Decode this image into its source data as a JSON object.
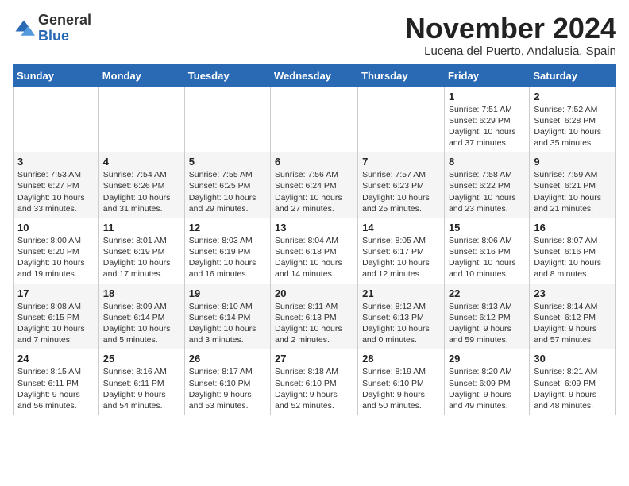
{
  "logo": {
    "general": "General",
    "blue": "Blue"
  },
  "header": {
    "month": "November 2024",
    "location": "Lucena del Puerto, Andalusia, Spain"
  },
  "weekdays": [
    "Sunday",
    "Monday",
    "Tuesday",
    "Wednesday",
    "Thursday",
    "Friday",
    "Saturday"
  ],
  "weeks": [
    [
      {
        "day": "",
        "info": ""
      },
      {
        "day": "",
        "info": ""
      },
      {
        "day": "",
        "info": ""
      },
      {
        "day": "",
        "info": ""
      },
      {
        "day": "",
        "info": ""
      },
      {
        "day": "1",
        "info": "Sunrise: 7:51 AM\nSunset: 6:29 PM\nDaylight: 10 hours and 37 minutes."
      },
      {
        "day": "2",
        "info": "Sunrise: 7:52 AM\nSunset: 6:28 PM\nDaylight: 10 hours and 35 minutes."
      }
    ],
    [
      {
        "day": "3",
        "info": "Sunrise: 7:53 AM\nSunset: 6:27 PM\nDaylight: 10 hours and 33 minutes."
      },
      {
        "day": "4",
        "info": "Sunrise: 7:54 AM\nSunset: 6:26 PM\nDaylight: 10 hours and 31 minutes."
      },
      {
        "day": "5",
        "info": "Sunrise: 7:55 AM\nSunset: 6:25 PM\nDaylight: 10 hours and 29 minutes."
      },
      {
        "day": "6",
        "info": "Sunrise: 7:56 AM\nSunset: 6:24 PM\nDaylight: 10 hours and 27 minutes."
      },
      {
        "day": "7",
        "info": "Sunrise: 7:57 AM\nSunset: 6:23 PM\nDaylight: 10 hours and 25 minutes."
      },
      {
        "day": "8",
        "info": "Sunrise: 7:58 AM\nSunset: 6:22 PM\nDaylight: 10 hours and 23 minutes."
      },
      {
        "day": "9",
        "info": "Sunrise: 7:59 AM\nSunset: 6:21 PM\nDaylight: 10 hours and 21 minutes."
      }
    ],
    [
      {
        "day": "10",
        "info": "Sunrise: 8:00 AM\nSunset: 6:20 PM\nDaylight: 10 hours and 19 minutes."
      },
      {
        "day": "11",
        "info": "Sunrise: 8:01 AM\nSunset: 6:19 PM\nDaylight: 10 hours and 17 minutes."
      },
      {
        "day": "12",
        "info": "Sunrise: 8:03 AM\nSunset: 6:19 PM\nDaylight: 10 hours and 16 minutes."
      },
      {
        "day": "13",
        "info": "Sunrise: 8:04 AM\nSunset: 6:18 PM\nDaylight: 10 hours and 14 minutes."
      },
      {
        "day": "14",
        "info": "Sunrise: 8:05 AM\nSunset: 6:17 PM\nDaylight: 10 hours and 12 minutes."
      },
      {
        "day": "15",
        "info": "Sunrise: 8:06 AM\nSunset: 6:16 PM\nDaylight: 10 hours and 10 minutes."
      },
      {
        "day": "16",
        "info": "Sunrise: 8:07 AM\nSunset: 6:16 PM\nDaylight: 10 hours and 8 minutes."
      }
    ],
    [
      {
        "day": "17",
        "info": "Sunrise: 8:08 AM\nSunset: 6:15 PM\nDaylight: 10 hours and 7 minutes."
      },
      {
        "day": "18",
        "info": "Sunrise: 8:09 AM\nSunset: 6:14 PM\nDaylight: 10 hours and 5 minutes."
      },
      {
        "day": "19",
        "info": "Sunrise: 8:10 AM\nSunset: 6:14 PM\nDaylight: 10 hours and 3 minutes."
      },
      {
        "day": "20",
        "info": "Sunrise: 8:11 AM\nSunset: 6:13 PM\nDaylight: 10 hours and 2 minutes."
      },
      {
        "day": "21",
        "info": "Sunrise: 8:12 AM\nSunset: 6:13 PM\nDaylight: 10 hours and 0 minutes."
      },
      {
        "day": "22",
        "info": "Sunrise: 8:13 AM\nSunset: 6:12 PM\nDaylight: 9 hours and 59 minutes."
      },
      {
        "day": "23",
        "info": "Sunrise: 8:14 AM\nSunset: 6:12 PM\nDaylight: 9 hours and 57 minutes."
      }
    ],
    [
      {
        "day": "24",
        "info": "Sunrise: 8:15 AM\nSunset: 6:11 PM\nDaylight: 9 hours and 56 minutes."
      },
      {
        "day": "25",
        "info": "Sunrise: 8:16 AM\nSunset: 6:11 PM\nDaylight: 9 hours and 54 minutes."
      },
      {
        "day": "26",
        "info": "Sunrise: 8:17 AM\nSunset: 6:10 PM\nDaylight: 9 hours and 53 minutes."
      },
      {
        "day": "27",
        "info": "Sunrise: 8:18 AM\nSunset: 6:10 PM\nDaylight: 9 hours and 52 minutes."
      },
      {
        "day": "28",
        "info": "Sunrise: 8:19 AM\nSunset: 6:10 PM\nDaylight: 9 hours and 50 minutes."
      },
      {
        "day": "29",
        "info": "Sunrise: 8:20 AM\nSunset: 6:09 PM\nDaylight: 9 hours and 49 minutes."
      },
      {
        "day": "30",
        "info": "Sunrise: 8:21 AM\nSunset: 6:09 PM\nDaylight: 9 hours and 48 minutes."
      }
    ]
  ]
}
